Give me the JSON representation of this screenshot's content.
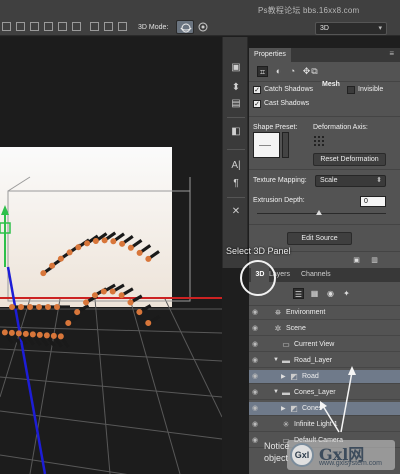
{
  "topbar": {
    "mode_label": "3D Mode:",
    "view_select": "3D",
    "watermark": "Ps教程论坛 bbs.16xx8.com"
  },
  "properties": {
    "tab": "Properties",
    "mesh_label": "Mesh",
    "catch_shadows": "Catch Shadows",
    "invisible": "Invisible",
    "cast_shadows": "Cast Shadows",
    "shape_preset": "Shape Preset:",
    "deformation_axis": "Deformation Axis:",
    "reset_deformation": "Reset Deformation",
    "texture_mapping": "Texture Mapping:",
    "texture_mapping_value": "Scale",
    "extrusion_depth": "Extrusion Depth:",
    "extrusion_depth_value": "0",
    "extrusion_slider_fraction": 0.5,
    "edit_source": "Edit Source"
  },
  "caption": "Select 3D Panel",
  "panel3d": {
    "tabs": [
      "3D",
      "Layers",
      "Channels"
    ],
    "rows": [
      {
        "label": "Environment",
        "icon": "environment-icon",
        "indent": 0,
        "twirl": false,
        "selected": false
      },
      {
        "label": "Scene",
        "icon": "scene-icon",
        "indent": 0,
        "twirl": false,
        "selected": false
      },
      {
        "label": "Current View",
        "icon": "camera-icon",
        "indent": 1,
        "twirl": false,
        "selected": false
      },
      {
        "label": "Road_Layer",
        "icon": "folder-icon",
        "indent": 1,
        "twirl": true,
        "selected": false
      },
      {
        "label": "Road",
        "icon": "mesh-icon",
        "indent": 2,
        "twirl": true,
        "selected": true
      },
      {
        "label": "Cones_Layer",
        "icon": "folder-icon",
        "indent": 1,
        "twirl": true,
        "selected": false
      },
      {
        "label": "Cones",
        "icon": "mesh-icon",
        "indent": 2,
        "twirl": true,
        "selected": true
      },
      {
        "label": "Infinite Light 1",
        "icon": "light-icon",
        "indent": 1,
        "twirl": false,
        "selected": false
      },
      {
        "label": "Default Camera",
        "icon": "camera-icon",
        "indent": 1,
        "twirl": false,
        "selected": false
      }
    ]
  },
  "note": {
    "line1": "Notice",
    "line2": "object"
  },
  "logo": {
    "mark": "Gxl",
    "name": "Gxl网",
    "url": "www.gxlsystem.com"
  },
  "colors": {
    "accent_red": "#cc2222",
    "axis_blue": "#1d1dd6",
    "axis_green": "#2ec04a",
    "cone_orange": "#d8763a"
  }
}
